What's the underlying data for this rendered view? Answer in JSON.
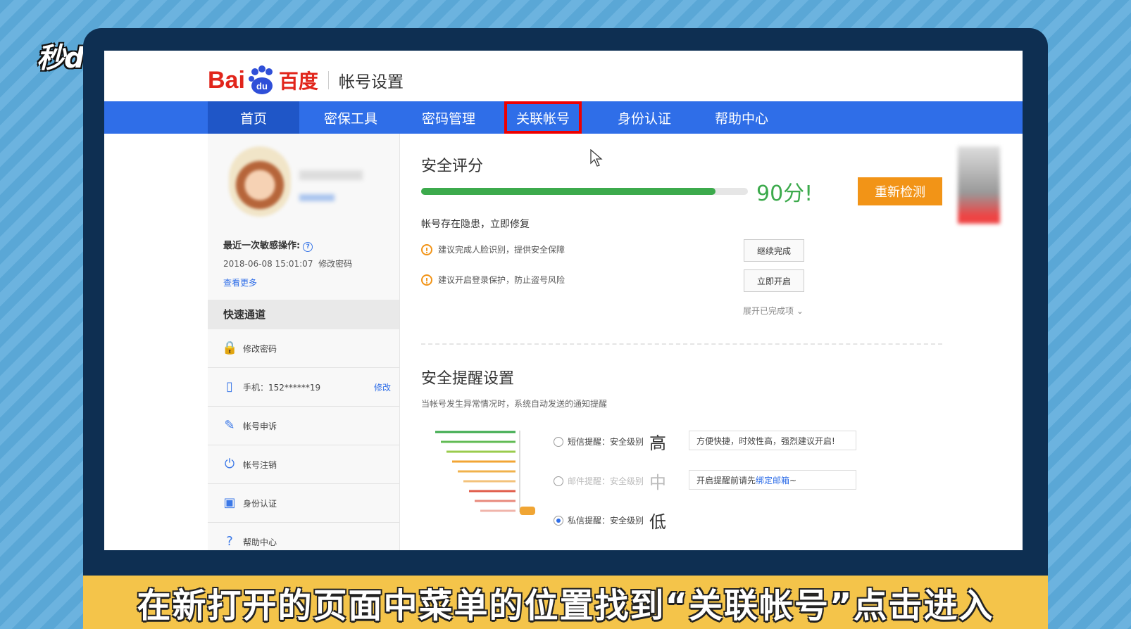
{
  "watermark": "秒dong视频",
  "caption": "在新打开的页面中菜单的位置找到“关联帐号”点击进入",
  "header": {
    "logo_left": "Bai",
    "logo_paw": "du",
    "logo_right": "百度",
    "title": "帐号设置"
  },
  "nav": {
    "items": [
      "首页",
      "密保工具",
      "密码管理",
      "关联帐号",
      "身份认证",
      "帮助中心"
    ]
  },
  "sidebar": {
    "recent_label": "最近一次敏感操作:",
    "recent_time": "2018-06-08 15:01:07",
    "recent_action": "修改密码",
    "more_link": "查看更多",
    "quick_title": "快速通道",
    "quick_items": [
      {
        "label": "修改密码",
        "icon": "lock-icon"
      },
      {
        "label": "手机：152******19",
        "link": "修改",
        "icon": "phone-icon"
      },
      {
        "label": "帐号申诉",
        "icon": "edit-icon"
      },
      {
        "label": "帐号注销",
        "icon": "power-icon"
      },
      {
        "label": "身份认证",
        "icon": "id-card-icon"
      },
      {
        "label": "帮助中心",
        "icon": "help-icon"
      }
    ]
  },
  "security": {
    "title": "安全评分",
    "score_percent": 90,
    "score_text": "90分!",
    "recheck_label": "重新检测",
    "warning_head": "帐号存在隐患，立即修复",
    "warnings": [
      {
        "text": "建议完成人脸识别，提供安全保障",
        "button": "继续完成"
      },
      {
        "text": "建议开启登录保护，防止盗号风险",
        "button": "立即开启"
      }
    ],
    "expand_label": "展开已完成项"
  },
  "reminder": {
    "title": "安全提醒设置",
    "desc": "当帐号发生异常情况时，系统自动发送的通知提醒",
    "options": [
      {
        "label": "短信提醒：安全级别",
        "level": "高",
        "tip": "方便快捷，时效性高，强烈建议开启!",
        "selected": false
      },
      {
        "label": "邮件提醒：安全级别",
        "level": "中",
        "tip_prefix": "开启提醒前请先",
        "tip_link": "绑定邮箱",
        "tip_suffix": "~",
        "selected": false
      },
      {
        "label": "私信提醒：安全级别",
        "level": "低",
        "selected": true
      }
    ]
  },
  "colors": {
    "nav_blue": "#2f6ee8",
    "score_green": "#3caa4c",
    "accent_orange": "#f29417",
    "highlight_red": "#e00000",
    "caption_yellow": "#f4c44a"
  }
}
